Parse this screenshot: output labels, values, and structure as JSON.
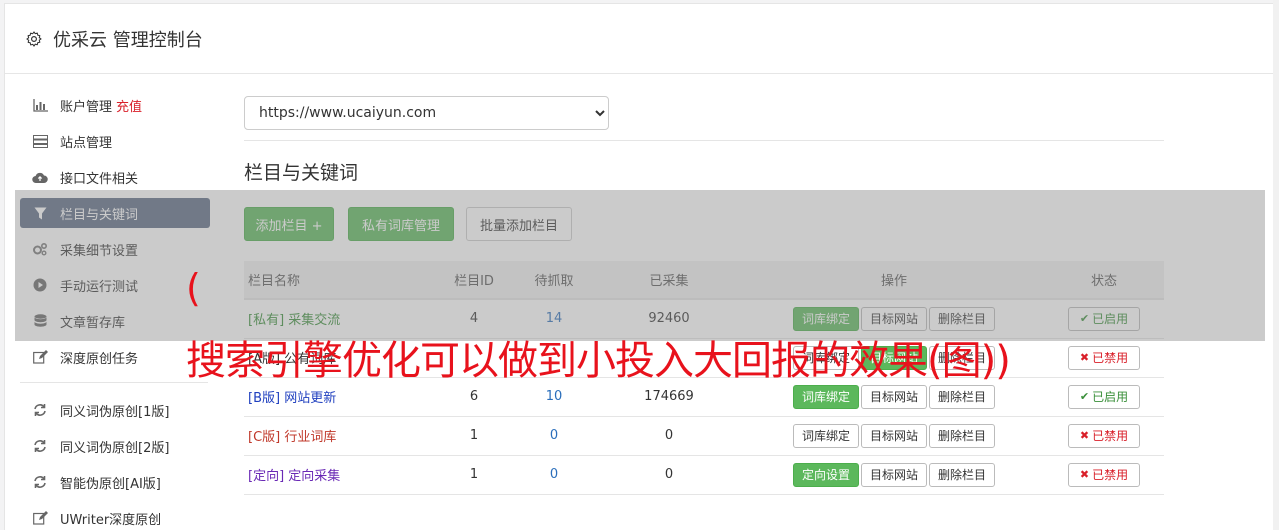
{
  "header": {
    "title": "优采云 管理控制台",
    "icon": "gear-icon"
  },
  "sidebar": {
    "items": [
      {
        "label": "账户管理",
        "extra": "充值",
        "icon": "bar-chart-icon"
      },
      {
        "label": "站点管理",
        "icon": "server-icon"
      },
      {
        "label": "接口文件相关",
        "icon": "cloud-upload-icon"
      },
      {
        "label": "栏目与关键词",
        "icon": "filter-icon",
        "active": true
      },
      {
        "label": "采集细节设置",
        "icon": "cogs-icon"
      },
      {
        "label": "手动运行测试",
        "icon": "play-circle-icon"
      },
      {
        "label": "文章暂存库",
        "icon": "database-icon"
      },
      {
        "label": "深度原创任务",
        "icon": "edit-icon"
      }
    ],
    "items2": [
      {
        "label": "同义词伪原创[1版]",
        "icon": "refresh-icon"
      },
      {
        "label": "同义词伪原创[2版]",
        "icon": "refresh-icon"
      },
      {
        "label": "智能伪原创[AI版]",
        "icon": "refresh-icon"
      },
      {
        "label": "UWriter深度原创",
        "icon": "edit-icon"
      }
    ]
  },
  "site_select": {
    "value": "https://www.ucaiyun.com"
  },
  "section": {
    "title": "栏目与关键词"
  },
  "toolbar": {
    "add_label": "添加栏目 +",
    "private_label": "私有词库管理",
    "batch_label": "批量添加栏目"
  },
  "table": {
    "headers": {
      "name": "栏目名称",
      "id": "栏目ID",
      "pending": "待抓取",
      "collected": "已采集",
      "ops": "操作",
      "status": "状态"
    },
    "rows": [
      {
        "tag": "[私有]",
        "name": "采集交流",
        "id": "4",
        "pending": "14",
        "collected": "92460",
        "bind": "词库绑定",
        "target": "目标网站",
        "del": "删除栏目",
        "status": "已启用"
      },
      {
        "tag": "[A版]",
        "name": "公有词库",
        "id": "",
        "pending": "",
        "collected": "",
        "bind": "词库绑定",
        "target": "目标网站",
        "del": "删除栏目",
        "status": "已禁用"
      },
      {
        "tag": "[B版]",
        "name": "网站更新",
        "id": "6",
        "pending": "10",
        "collected": "174669",
        "bind": "词库绑定",
        "target": "目标网站",
        "del": "删除栏目",
        "status": "已启用"
      },
      {
        "tag": "[C版]",
        "name": "行业词库",
        "id": "1",
        "pending": "0",
        "collected": "0",
        "bind": "词库绑定",
        "target": "目标网站",
        "del": "删除栏目",
        "status": "已禁用"
      },
      {
        "tag": "[定向]",
        "name": "定向采集",
        "id": "1",
        "pending": "0",
        "collected": "0",
        "bind": "定向设置",
        "target": "目标网站",
        "del": "删除栏目",
        "status": "已禁用"
      }
    ]
  },
  "overlay": {
    "paren": "(",
    "text": "搜索引擎优化可以做到小投入大回报的效果(图))"
  },
  "colors": {
    "accent_green": "#5cb85c",
    "active_nav": "#5b6a84",
    "overlay_red": "#e8121c",
    "link_blue": "#2a6ebb"
  }
}
